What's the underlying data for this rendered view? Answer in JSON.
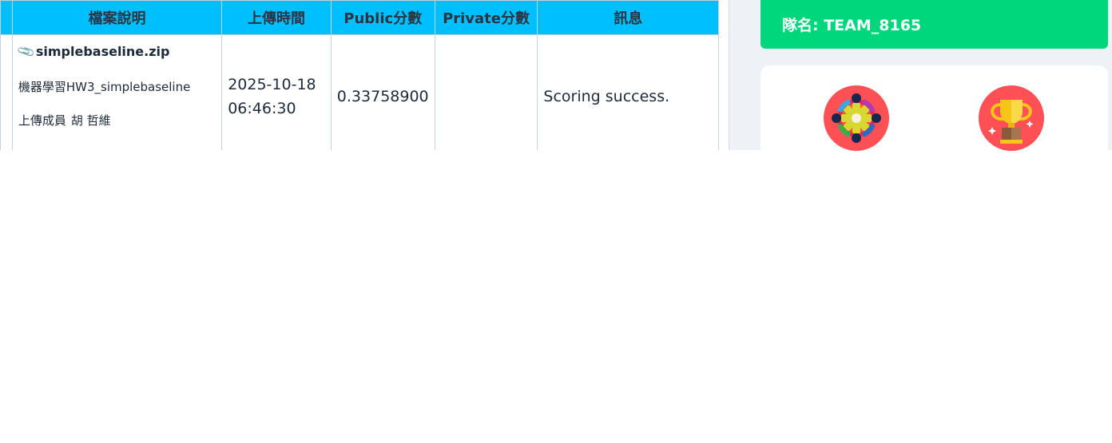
{
  "table": {
    "headers": [
      "",
      "檔案說明",
      "上傳時間",
      "Public分數",
      "Private分數",
      "訊息"
    ],
    "rows": [
      {
        "file_name": "simplebaseline.zip",
        "description": "機器學習HW3_simplebaseline",
        "uploader_label": "上傳成員",
        "uploader_name": "胡 哲維",
        "upload_date": "2025-10-18",
        "upload_time": "06:46:30",
        "public_score": "0.33758900",
        "private_score": "",
        "message": "Scoring success."
      }
    ]
  },
  "sidebar": {
    "team_label": "隊名: TEAM_8165",
    "badges": [
      {
        "icon": "team-gear-badge-icon"
      },
      {
        "icon": "trophy-badge-icon"
      }
    ]
  },
  "colors": {
    "header_bg": "#00bfff",
    "team_card_bg": "#00d67c",
    "badge_bg": "#ff5056",
    "panel_bg": "#eef2f6"
  }
}
